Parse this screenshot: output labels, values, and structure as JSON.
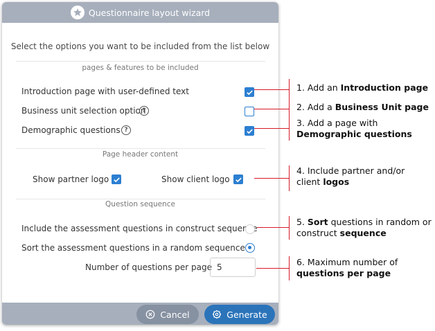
{
  "dialog": {
    "title": "Questionnaire layout wizard",
    "intro": "Select the options you want to be included from the list below"
  },
  "sections": {
    "pages": {
      "label": "pages & features to be included",
      "options": [
        {
          "label": "Introduction page with user-defined text",
          "checked": true
        },
        {
          "label": "Business unit selection option",
          "checked": false
        },
        {
          "label": "Demographic questions",
          "checked": true
        }
      ]
    },
    "header": {
      "label": "Page header content",
      "partner_logo": "Show partner logo",
      "client_logo": "Show client logo"
    },
    "sequence": {
      "label": "Question sequence",
      "construct": "Include the assessment questions in construct sequence",
      "random": "Sort the assessment questions in a random sequence",
      "per_page_label": "Number of questions per page",
      "per_page_value": "5"
    }
  },
  "footer": {
    "cancel": "Cancel",
    "generate": "Generate"
  },
  "callouts": {
    "c1": {
      "pre": "1. Add an ",
      "bold": "Introduction page"
    },
    "c2": {
      "pre": "2. Add a ",
      "bold": "Business Unit page"
    },
    "c3": {
      "line1": "3. Add a page with",
      "bold": "Demographic questions"
    },
    "c4": {
      "line1": "4. Include partner and/or",
      "pre2": "client ",
      "bold": "logos"
    },
    "c5": {
      "pre": "5. ",
      "bold1": "Sort",
      "mid": " questions in random or",
      "pre2": "construct ",
      "bold2": "sequence"
    },
    "c6": {
      "line1": "6. Maximum number of",
      "bold": "questions per page"
    }
  },
  "colors": {
    "accent": "#2c7fd1",
    "titlebar": "#a7afbc",
    "generate_button": "#2b74ba",
    "cancel_button": "#8691a1",
    "callout_line": "#d6192a"
  }
}
